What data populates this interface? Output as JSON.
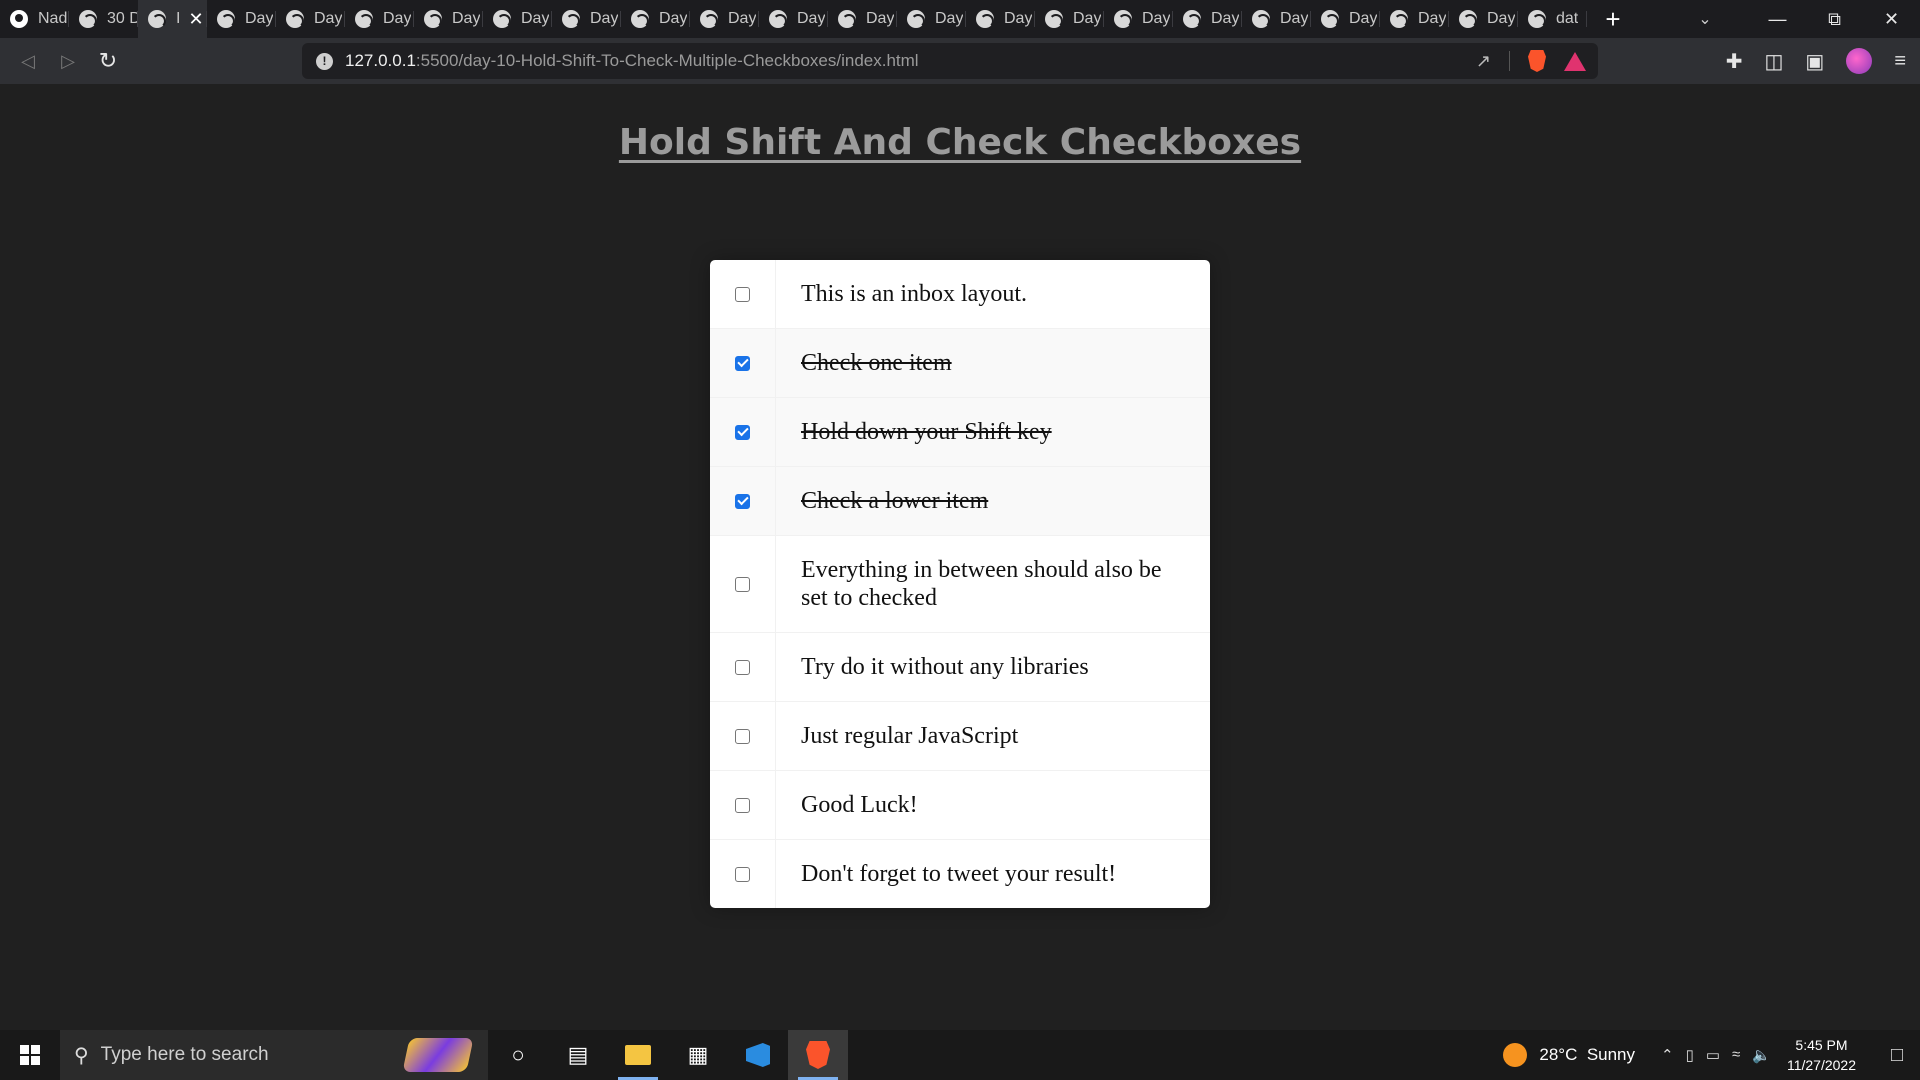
{
  "browser": {
    "tabs": [
      {
        "label": "Nad",
        "icon": "github-icon"
      },
      {
        "label": "30 D",
        "icon": "globe-icon"
      },
      {
        "label": "I",
        "icon": "globe-icon",
        "active": true
      },
      {
        "label": "Day",
        "icon": "globe-icon"
      },
      {
        "label": "Day",
        "icon": "globe-icon"
      },
      {
        "label": "Day",
        "icon": "globe-icon"
      },
      {
        "label": "Day",
        "icon": "globe-icon"
      },
      {
        "label": "Day",
        "icon": "globe-icon"
      },
      {
        "label": "Day",
        "icon": "globe-icon"
      },
      {
        "label": "Day",
        "icon": "globe-icon"
      },
      {
        "label": "Day",
        "icon": "globe-icon"
      },
      {
        "label": "Day",
        "icon": "globe-icon"
      },
      {
        "label": "Day",
        "icon": "globe-icon"
      },
      {
        "label": "Day",
        "icon": "globe-icon"
      },
      {
        "label": "Day",
        "icon": "globe-icon"
      },
      {
        "label": "Day",
        "icon": "globe-icon"
      },
      {
        "label": "Day",
        "icon": "globe-icon"
      },
      {
        "label": "Day",
        "icon": "globe-icon"
      },
      {
        "label": "Day",
        "icon": "globe-icon"
      },
      {
        "label": "Day",
        "icon": "globe-icon"
      },
      {
        "label": "Day",
        "icon": "globe-icon"
      },
      {
        "label": "Day",
        "icon": "globe-icon"
      },
      {
        "label": "dat",
        "icon": "globe-icon"
      }
    ],
    "url_host": "127.0.0.1",
    "url_path": ":5500/day-10-Hold-Shift-To-Check-Multiple-Checkboxes/index.html"
  },
  "page": {
    "heading": "Hold Shift And Check Checkboxes",
    "items": [
      {
        "text": "This is an inbox layout.",
        "checked": false
      },
      {
        "text": "Check one item",
        "checked": true
      },
      {
        "text": "Hold down your Shift key",
        "checked": true
      },
      {
        "text": "Check a lower item",
        "checked": true
      },
      {
        "text": "Everything in between should also be set to checked",
        "checked": false
      },
      {
        "text": "Try do it without any libraries",
        "checked": false
      },
      {
        "text": "Just regular JavaScript",
        "checked": false
      },
      {
        "text": "Good Luck!",
        "checked": false
      },
      {
        "text": "Don't forget to tweet your result!",
        "checked": false
      }
    ]
  },
  "taskbar": {
    "search_placeholder": "Type here to search",
    "weather_temp": "28°C",
    "weather_text": "Sunny",
    "time": "5:45 PM",
    "date": "11/27/2022"
  },
  "colors": {
    "page_bg": "#202020",
    "heading": "#9b9b9b",
    "checkbox_checked": "#1a73e8"
  }
}
